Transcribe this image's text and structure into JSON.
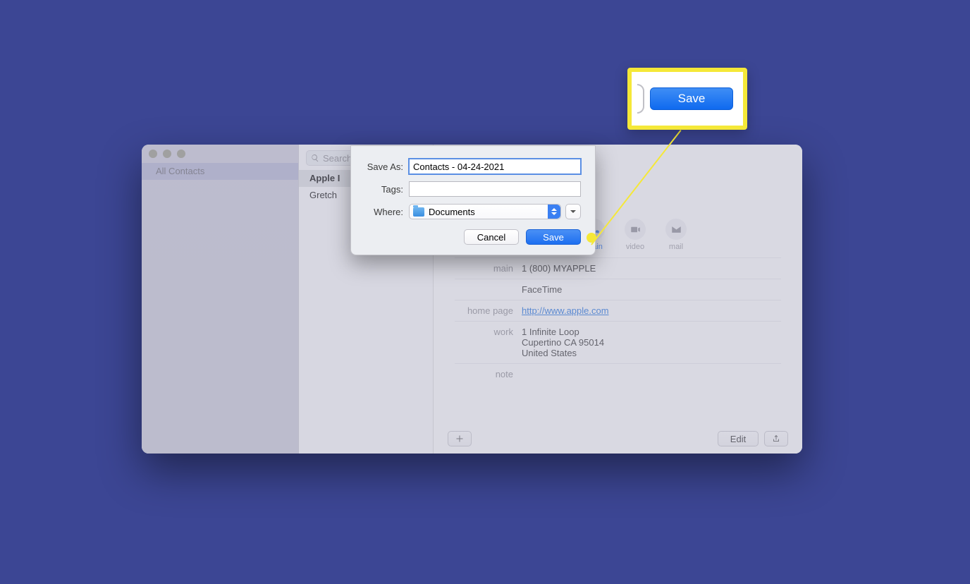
{
  "sidebar": {
    "all_contacts": "All Contacts"
  },
  "search": {
    "placeholder": "Search"
  },
  "list": {
    "item0": "Apple I",
    "item1": "Gretch"
  },
  "actions": {
    "main": "main",
    "video": "video",
    "mail": "mail"
  },
  "details": {
    "main_label": "main",
    "main_value": "1 (800) MYAPPLE",
    "facetime": "FaceTime",
    "homepage_label": "home page",
    "homepage_value": "http://www.apple.com",
    "work_label": "work",
    "work_line1": "1 Infinite Loop",
    "work_line2": "Cupertino CA 95014",
    "work_line3": "United States",
    "note_label": "note"
  },
  "bottom": {
    "edit": "Edit"
  },
  "sheet": {
    "saveas_label": "Save As:",
    "saveas_value": "Contacts - 04-24-2021",
    "tags_label": "Tags:",
    "tags_value": "",
    "where_label": "Where:",
    "where_value": "Documents",
    "cancel": "Cancel",
    "save": "Save"
  },
  "callout": {
    "save": "Save"
  }
}
